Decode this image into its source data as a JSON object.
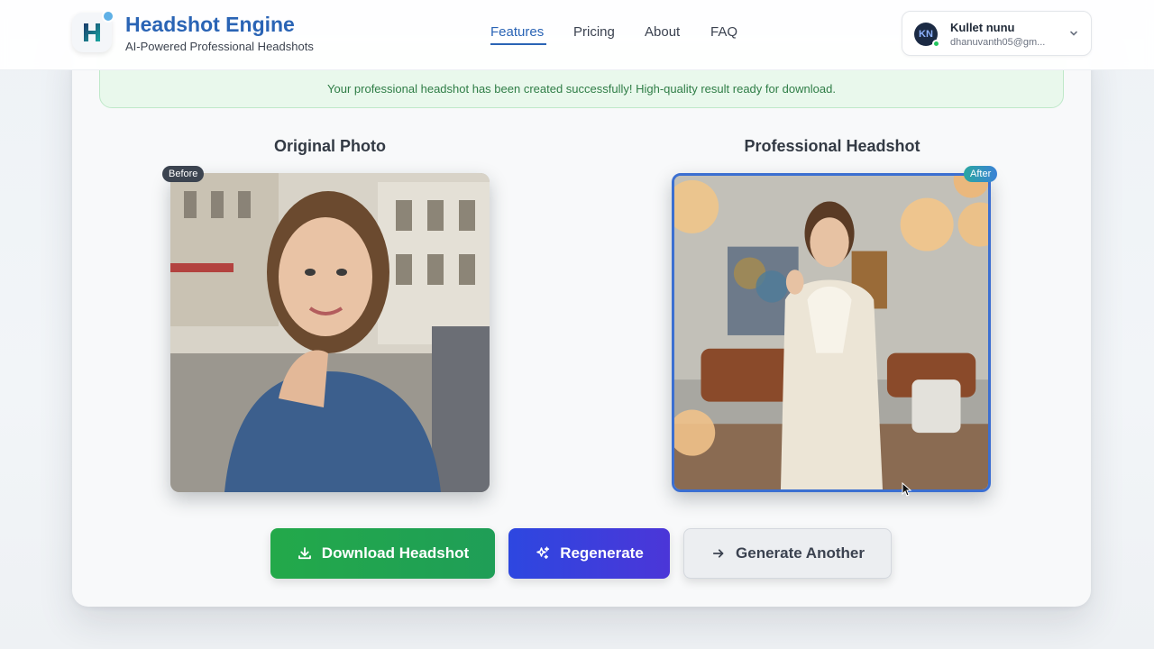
{
  "header": {
    "brand_title": "Headshot Engine",
    "brand_subtitle": "AI-Powered Professional Headshots",
    "nav": [
      {
        "label": "Features",
        "active": true
      },
      {
        "label": "Pricing",
        "active": false
      },
      {
        "label": "About",
        "active": false
      },
      {
        "label": "FAQ",
        "active": false
      }
    ],
    "user": {
      "initials": "KN",
      "name": "Kullet nunu",
      "email": "dhanuvanth05@gm...",
      "status": "online"
    }
  },
  "banner": {
    "message": "Your professional headshot has been created successfully! High-quality result ready for download."
  },
  "comparison": {
    "original_title": "Original Photo",
    "original_badge": "Before",
    "result_title": "Professional Headshot",
    "result_badge": "After"
  },
  "actions": {
    "download_label": "Download Headshot",
    "regenerate_label": "Regenerate",
    "another_label": "Generate Another"
  },
  "colors": {
    "brand": "#2a64b5",
    "success_bg": "#e9f8ec",
    "download": "#23a94a",
    "regenerate": "#2d47e0"
  }
}
